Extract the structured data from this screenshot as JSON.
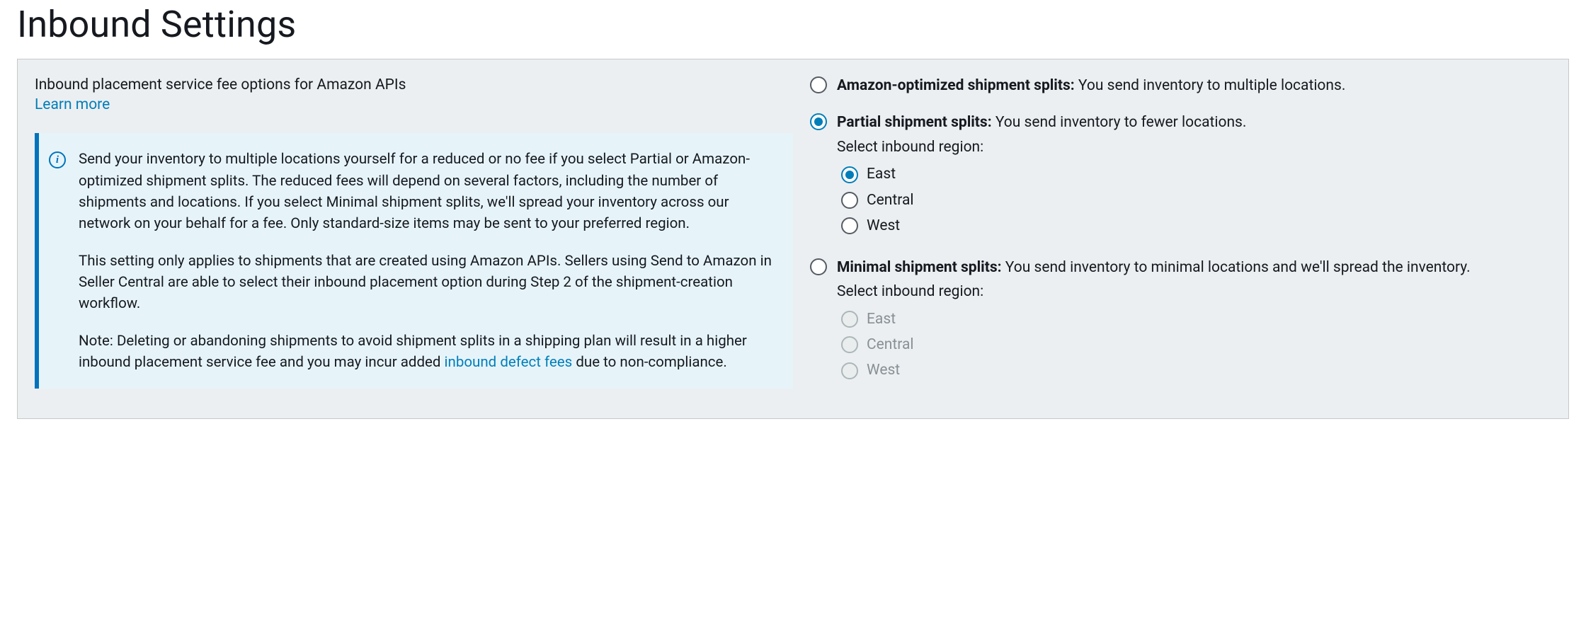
{
  "page": {
    "title": "Inbound Settings",
    "intro_label": "Inbound placement service fee options for Amazon APIs",
    "learn_more": "Learn more"
  },
  "info": {
    "para1": "Send your inventory to multiple locations yourself for a reduced or no fee if you select Partial or Amazon-optimized shipment splits. The reduced fees will depend on several factors, including the number of shipments and locations. If you select Minimal shipment splits, we'll spread your inventory across our network on your behalf for a fee. Only standard-size items may be sent to your preferred region.",
    "para2": "This setting only applies to shipments that are created using Amazon APIs. Sellers using Send to Amazon in Seller Central are able to select their inbound placement option during Step 2 of the shipment-creation workflow.",
    "para3_prefix": "Note: Deleting or abandoning shipments to avoid shipment splits in a shipping plan will result in a higher inbound placement service fee and you may incur added ",
    "para3_link": "inbound defect fees",
    "para3_suffix": " due to non-compliance."
  },
  "options": {
    "amazon": {
      "title": "Amazon-optimized shipment splits:",
      "desc": " You send inventory to multiple locations.",
      "selected": false
    },
    "partial": {
      "title": "Partial shipment splits:",
      "desc": " You send inventory to fewer locations.",
      "selected": true,
      "sub_label": "Select inbound region:",
      "regions": {
        "east": {
          "label": "East",
          "selected": true
        },
        "central": {
          "label": "Central",
          "selected": false
        },
        "west": {
          "label": "West",
          "selected": false
        }
      }
    },
    "minimal": {
      "title": "Minimal shipment splits:",
      "desc": " You send inventory to minimal locations and we'll spread the inventory.",
      "selected": false,
      "sub_label": "Select inbound region:",
      "regions": {
        "east": {
          "label": "East"
        },
        "central": {
          "label": "Central"
        },
        "west": {
          "label": "West"
        }
      }
    }
  }
}
